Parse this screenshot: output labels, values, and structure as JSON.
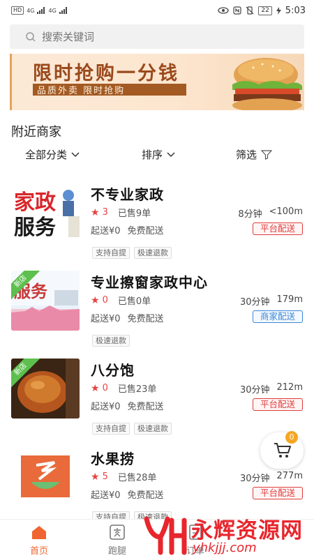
{
  "status_bar": {
    "left_tag": "HD",
    "sig1": "4G",
    "sig2": "4G",
    "battery": "22",
    "time": "5:03"
  },
  "search": {
    "placeholder": "搜索关键词"
  },
  "banner": {
    "title": "限时抢购一分钱",
    "subtitle": "品质外卖  限时抢购"
  },
  "section_title": "附近商家",
  "filters": {
    "category": "全部分类",
    "sort": "排序",
    "filter": "筛选"
  },
  "shops": [
    {
      "name": "不专业家政",
      "rating": "3",
      "sold": "已售9单",
      "time": "8分钟",
      "distance": "<100m",
      "min_order": "起送¥0",
      "delivery_fee": "免费配送",
      "delivery_type": "平台配送",
      "tags": [
        "支持自提",
        "极速退款"
      ],
      "is_new": false,
      "thumb_text1": "家政",
      "thumb_text2": "服务"
    },
    {
      "name": "专业擦窗家政中心",
      "rating": "0",
      "sold": "已售0单",
      "time": "30分钟",
      "distance": "179m",
      "min_order": "起送¥0",
      "delivery_fee": "免费配送",
      "delivery_type": "商家配送",
      "tags": [
        "极速退款"
      ],
      "is_new": true,
      "new_label": "新店",
      "thumb_text1": "服务"
    },
    {
      "name": "八分饱",
      "rating": "0",
      "sold": "已售23单",
      "time": "30分钟",
      "distance": "212m",
      "min_order": "起送¥0",
      "delivery_fee": "免费配送",
      "delivery_type": "平台配送",
      "tags": [
        "支持自提",
        "极速退款"
      ],
      "is_new": true,
      "new_label": "新店"
    },
    {
      "name": "水果捞",
      "rating": "5",
      "sold": "已售28单",
      "time": "30分钟",
      "distance": "277m",
      "min_order": "起送¥0",
      "delivery_fee": "免费配送",
      "delivery_type": "平台配送",
      "tags": [
        "支持自提",
        "极速退款"
      ],
      "is_new": false
    }
  ],
  "cart": {
    "count": "0"
  },
  "tabs": [
    {
      "label": "首页",
      "icon": "home-icon",
      "active": true
    },
    {
      "label": "跑腿",
      "icon": "errand-icon",
      "active": false
    },
    {
      "label": "订单",
      "icon": "order-icon",
      "active": false
    }
  ],
  "watermark": {
    "text": "永辉资源网",
    "url": "yhkjjj.com",
    "logo": "YH"
  },
  "colors": {
    "accent": "#f0642f",
    "price_red": "#e64340",
    "platform": "#e03a3a",
    "merchant": "#3b86d6"
  }
}
